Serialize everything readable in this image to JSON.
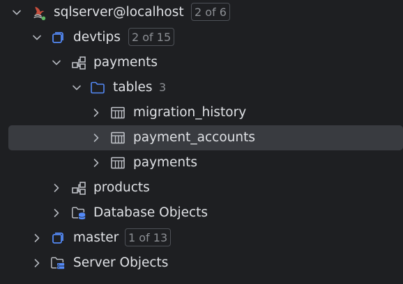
{
  "tree": {
    "server": {
      "label": "sqlserver@localhost",
      "badge": "2 of 6",
      "icon": "sqlserver-icon"
    },
    "devtips": {
      "label": "devtips",
      "badge": "2 of 15",
      "icon": "database-icon"
    },
    "payments_schema": {
      "label": "payments",
      "icon": "schema-icon"
    },
    "tables": {
      "label": "tables",
      "count": "3",
      "icon": "folder-icon"
    },
    "table_items": [
      {
        "label": "migration_history",
        "icon": "table-icon"
      },
      {
        "label": "payment_accounts",
        "icon": "table-icon",
        "selected": true
      },
      {
        "label": "payments",
        "icon": "table-icon"
      }
    ],
    "products_schema": {
      "label": "products",
      "icon": "schema-icon"
    },
    "database_objects": {
      "label": "Database Objects",
      "icon": "database-objects-folder-icon"
    },
    "master": {
      "label": "master",
      "badge": "1 of 13",
      "icon": "database-icon"
    },
    "server_objects": {
      "label": "Server Objects",
      "icon": "server-objects-folder-icon"
    }
  },
  "colors": {
    "background": "#1e1f22",
    "selection": "#393b40",
    "text": "#dfe1e5",
    "muted": "#8c8f94",
    "accent_blue": "#548af7",
    "online_green": "#5fb865"
  }
}
